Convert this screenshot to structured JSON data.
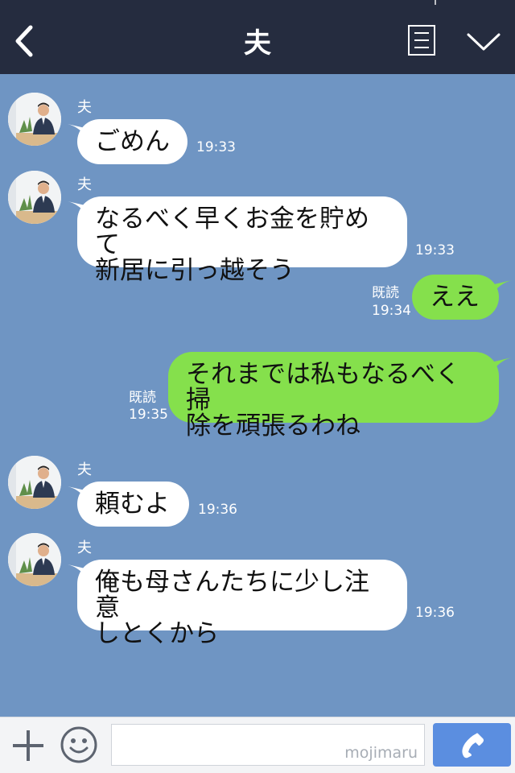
{
  "header": {
    "title": "夫"
  },
  "sender_name": "夫",
  "messages": [
    {
      "text": "ごめん",
      "time": "19:33"
    },
    {
      "text_lines": [
        "なるべく早くお金を貯めて",
        "新居に引っ越そう"
      ],
      "time": "19:33"
    },
    {
      "text": "ええ",
      "read": "既読",
      "time": "19:34"
    },
    {
      "text_lines": [
        "それまでは私もなるべく掃",
        "除を頑張るわね"
      ],
      "read": "既読",
      "time": "19:35"
    },
    {
      "text": "頼むよ",
      "time": "19:36"
    },
    {
      "text_lines": [
        "俺も母さんたちに少し注意",
        "しとくから"
      ],
      "time": "19:36"
    }
  ],
  "input": {
    "watermark": "mojimaru"
  },
  "icons": {
    "back": "chevron-left-icon",
    "notes": "notes-icon",
    "collapse": "chevron-down-icon",
    "plus": "plus-icon",
    "emoji": "smiley-icon",
    "call": "phone-icon"
  },
  "colors": {
    "header": "#252c3f",
    "background": "#6f95c3",
    "incoming": "#ffffff",
    "outgoing": "#85e04c",
    "call_button": "#5b8ee0"
  }
}
